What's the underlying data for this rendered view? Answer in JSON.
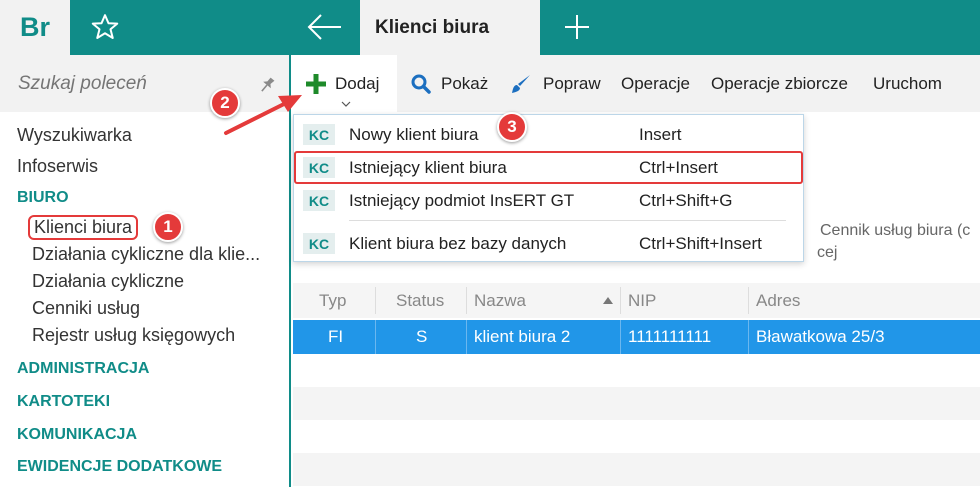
{
  "app": {
    "logo": "Br"
  },
  "tabs": {
    "active_label": "Klienci biura"
  },
  "sidebar": {
    "search_placeholder": "Szukaj poleceń",
    "items": [
      {
        "label": "Wyszukiwarka"
      },
      {
        "label": "Infoserwis"
      }
    ],
    "sections": [
      {
        "label": "BIURO"
      },
      {
        "label": "ADMINISTRACJA"
      },
      {
        "label": "KARTOTEKI"
      },
      {
        "label": "KOMUNIKACJA"
      },
      {
        "label": "EWIDENCJE DODATKOWE"
      }
    ],
    "biuro_items": [
      {
        "label": "Klienci biura"
      },
      {
        "label": "Działania cykliczne dla klie..."
      },
      {
        "label": "Działania cykliczne"
      },
      {
        "label": "Cenniki usług"
      },
      {
        "label": "Rejestr usług księgowych"
      }
    ]
  },
  "toolbar": {
    "dodaj": "Dodaj",
    "pokaz": "Pokaż",
    "popraw": "Popraw",
    "operacje": "Operacje",
    "operacje_zbiorcze": "Operacje zbiorcze",
    "uruchom": "Uruchom"
  },
  "dropdown": {
    "items": [
      {
        "badge": "KC",
        "label": "Nowy klient biura",
        "shortcut": "Insert"
      },
      {
        "badge": "KC",
        "label": "Istniejący klient biura",
        "shortcut": "Ctrl+Insert"
      },
      {
        "badge": "KC",
        "label": "Istniejący podmiot InsERT GT",
        "shortcut": "Ctrl+Shift+G"
      },
      {
        "badge": "KC",
        "label": "Klient biura bez bazy danych",
        "shortcut": "Ctrl+Shift+Insert"
      }
    ]
  },
  "filter": {
    "cennik_label": "Cennik usług biura (c",
    "cennik_line2": "cej"
  },
  "grid": {
    "columns": [
      "Typ",
      "Status",
      "Nazwa",
      "NIP",
      "Adres"
    ],
    "rows": [
      {
        "typ": "FI",
        "status": "S",
        "nazwa": "klient biura 2",
        "nip": "1111111111",
        "adres": "Bławatkowa 25/3"
      }
    ]
  },
  "annotations": [
    "1",
    "2",
    "3"
  ],
  "colors": {
    "accent": "#108c88",
    "selection": "#2196e8",
    "highlight": "#e43a3a"
  }
}
